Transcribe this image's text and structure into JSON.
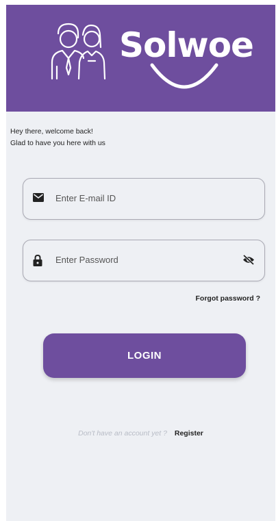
{
  "header": {
    "brand_name": "Solwoe",
    "brand_color": "#6e4e9e",
    "logo_icon": "two-people-icon"
  },
  "greeting": {
    "line1": "Hey there, welcome back!",
    "line2": "Glad to have you here with us"
  },
  "email_field": {
    "icon": "envelope-icon",
    "placeholder": "Enter E-mail ID"
  },
  "password_field": {
    "icon": "lock-icon",
    "placeholder": "Enter Password",
    "toggle_icon": "eye-off-icon"
  },
  "forgot_password": "Forgot password ?",
  "login_button": "LOGIN",
  "register_prompt": {
    "question": "Don't have an account yet ?",
    "link": "Register"
  }
}
